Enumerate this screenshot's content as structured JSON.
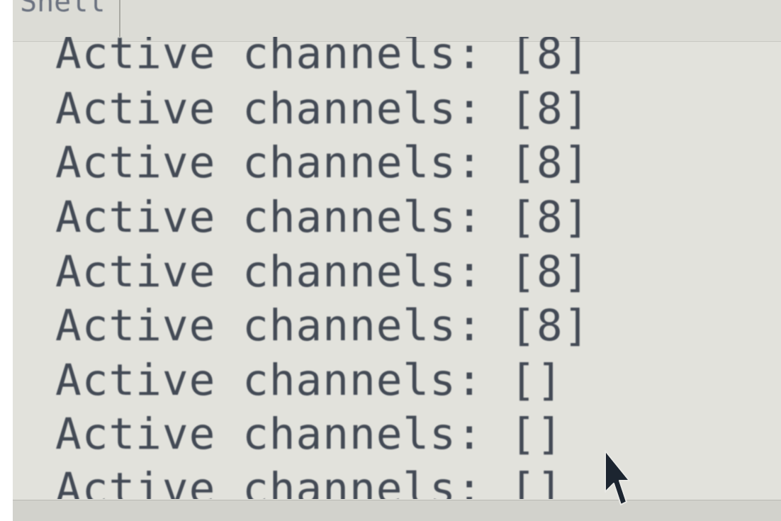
{
  "tab": {
    "label": "Shell"
  },
  "output": {
    "lines": [
      "Active channels: [8]",
      "Active channels: [8]",
      "Active channels: [8]",
      "Active channels: [8]",
      "Active channels: [8]",
      "Active channels: [8]",
      "Active channels: []",
      "Active channels: []",
      "Active channels: []"
    ]
  },
  "cursor": {
    "icon": "mouse-pointer-icon"
  },
  "colors": {
    "text": "#434a55",
    "background": "#e2e2dc"
  }
}
